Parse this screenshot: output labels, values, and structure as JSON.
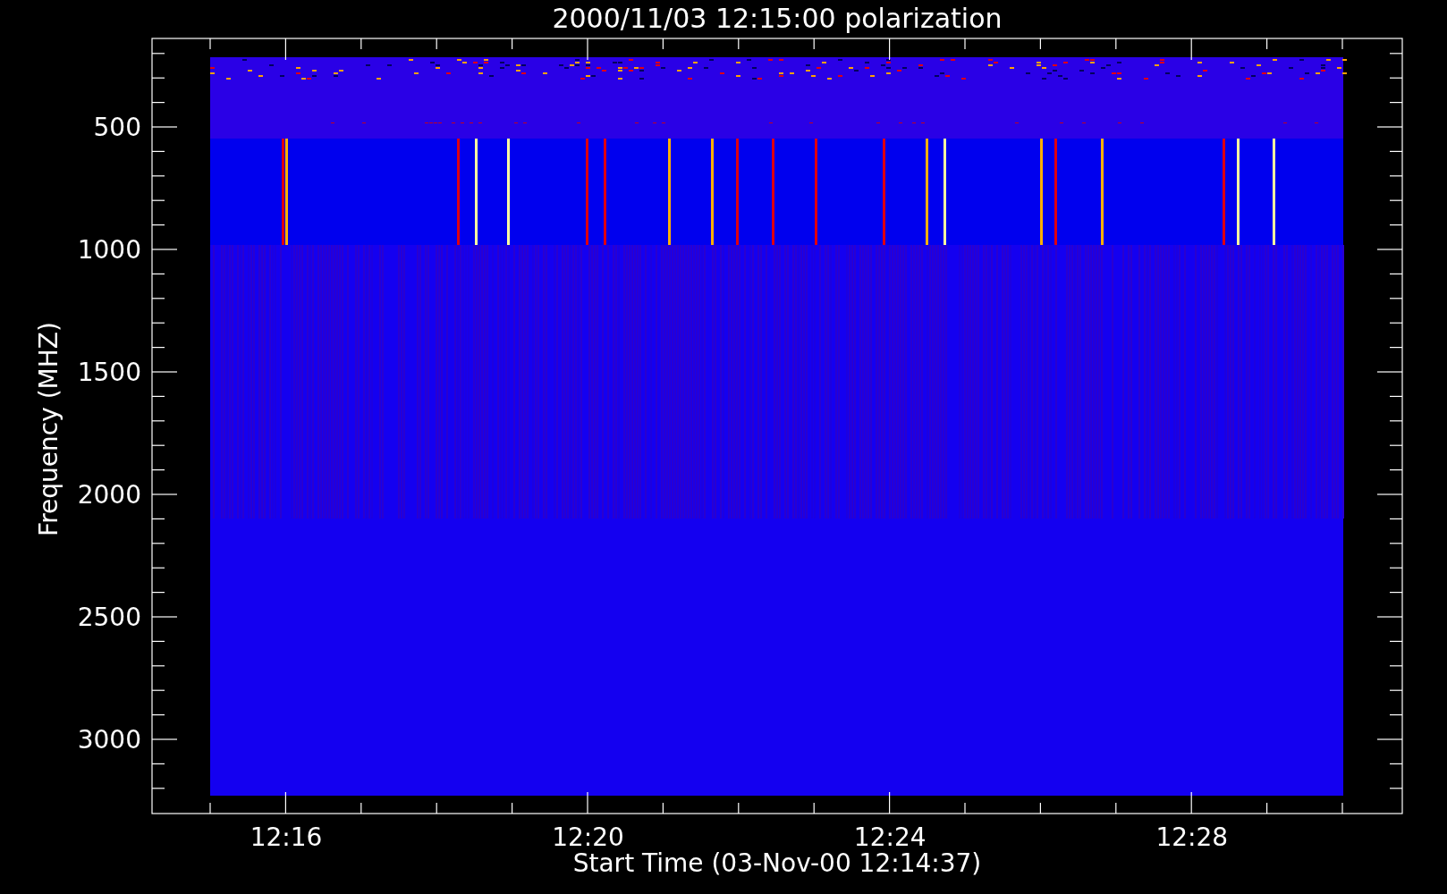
{
  "plot": {
    "title": "2000/11/03 12:15:00 polarization",
    "ylabel": "Frequency (MHZ)",
    "xlabel": "Start Time (03-Nov-00 12:14:37)",
    "y_tick_labels": [
      "500",
      "1000",
      "1500",
      "2000",
      "2500",
      "3000"
    ],
    "x_tick_labels": [
      "12:16",
      "12:20",
      "12:24",
      "12:28"
    ]
  }
}
